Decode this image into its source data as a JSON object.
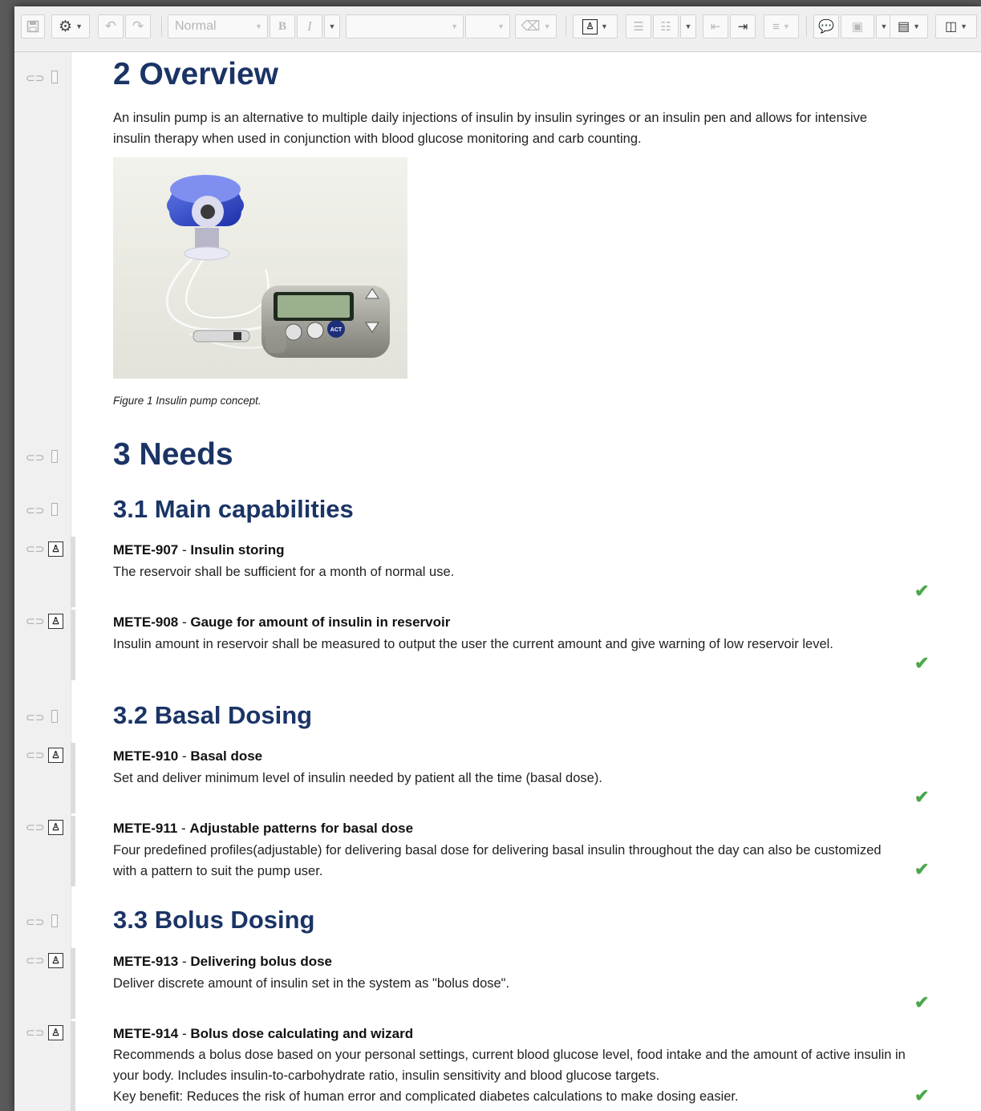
{
  "toolbar": {
    "style_select": "Normal",
    "bold": "B",
    "italic": "I"
  },
  "doc": {
    "h_overview": "2 Overview",
    "overview_text": "An insulin pump is an alternative to multiple daily injections of insulin by insulin syringes or an insulin pen and allows for intensive insulin therapy when used in conjunction with blood glucose monitoring and carb counting.",
    "figure_caption": "Figure 1 Insulin pump concept.",
    "pump_display_button": "ACT",
    "h_needs": "3 Needs",
    "h_main": "3.1 Main capabilities",
    "h_basal": "3.2 Basal Dosing",
    "h_bolus": "3.3 Bolus Dosing"
  },
  "requirements": [
    {
      "id": "METE-907",
      "sep": " - ",
      "title": "Insulin storing",
      "lines": [
        "The reservoir shall be sufficient for a month of normal use."
      ]
    },
    {
      "id": "METE-908",
      "sep": " - ",
      "title": "Gauge for amount of insulin in reservoir",
      "lines": [
        "Insulin amount in reservoir shall be measured to output the user the current amount and give warning of low reservoir level."
      ]
    },
    {
      "id": "METE-910",
      "sep": " - ",
      "title": "Basal dose",
      "lines": [
        "Set and deliver minimum level of insulin needed by patient all the time (basal dose)."
      ]
    },
    {
      "id": "METE-911",
      "sep": " - ",
      "title": "Adjustable patterns for basal dose",
      "lines": [
        "Four predefined profiles(adjustable) for delivering basal dose for delivering basal insulin throughout the day can also be customized with a pattern to suit the pump user."
      ]
    },
    {
      "id": "METE-913",
      "sep": " - ",
      "title": "Delivering bolus dose",
      "lines": [
        "Deliver discrete amount of insulin set in the system as \"bolus dose\"."
      ]
    },
    {
      "id": "METE-914",
      "sep": " - ",
      "title": "Bolus dose calculating and wizard",
      "lines": [
        "Recommends a bolus dose based on your personal settings, current blood glucose level, food intake and the amount of active insulin in your body. Includes insulin-to-carbohydrate ratio, insulin sensitivity and blood glucose targets.",
        "Key benefit: Reduces the risk of human error and complicated diabetes calculations to make dosing easier."
      ]
    }
  ],
  "colors": {
    "heading": "#1b3466",
    "check": "#4aa84a"
  }
}
